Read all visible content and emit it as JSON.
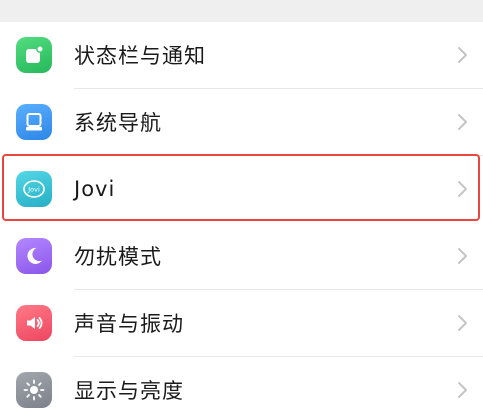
{
  "settings": {
    "items": [
      {
        "label": "状态栏与通知",
        "icon": "status-bar-notification-icon",
        "color": "#3ccf6e"
      },
      {
        "label": "系统导航",
        "icon": "system-navigation-icon",
        "color": "#3a9af0"
      },
      {
        "label": "Jovi",
        "icon": "jovi-icon",
        "color": "#3bc3d6"
      },
      {
        "label": "勿扰模式",
        "icon": "do-not-disturb-icon",
        "color": "#9e6bf0"
      },
      {
        "label": "声音与振动",
        "icon": "sound-vibration-icon",
        "color": "#f2556a"
      },
      {
        "label": "显示与亮度",
        "icon": "display-brightness-icon",
        "color": "#8a8f98"
      }
    ],
    "jovi_icon_text": "Jovi"
  },
  "colors": {
    "highlight": "#e8463e",
    "chevron": "#c4c4c4"
  }
}
